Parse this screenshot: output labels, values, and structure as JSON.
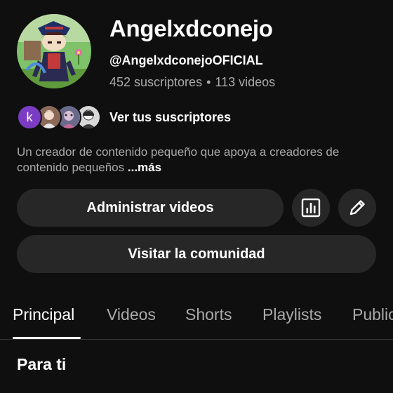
{
  "channel": {
    "name": "Angelxdconejo",
    "handle": "@AngelxdconejoOFICIAL",
    "subscribers": "452 suscriptores",
    "separator": "•",
    "videos": "113 videos"
  },
  "subscribers_row": {
    "first_avatar_letter": "k",
    "link_label": "Ver tus suscriptores"
  },
  "description": {
    "text": "Un creador de contenido pequeño que apoya a creadores de contenido pequeños",
    "more_label": "...más"
  },
  "actions": {
    "manage_videos_label": "Administrar videos",
    "community_label": "Visitar la comunidad",
    "analytics_icon": "bar-chart-icon",
    "edit_icon": "pencil-icon"
  },
  "tabs": [
    {
      "label": "Principal",
      "active": true
    },
    {
      "label": "Videos",
      "active": false
    },
    {
      "label": "Shorts",
      "active": false
    },
    {
      "label": "Playlists",
      "active": false
    },
    {
      "label": "Public",
      "active": false
    }
  ],
  "section": {
    "title": "Para ti"
  },
  "colors": {
    "background": "#0f0f0f",
    "button_background": "#272727",
    "secondary_text": "#aaaaaa",
    "avatar_letter_bg": "#7b3cc4"
  }
}
